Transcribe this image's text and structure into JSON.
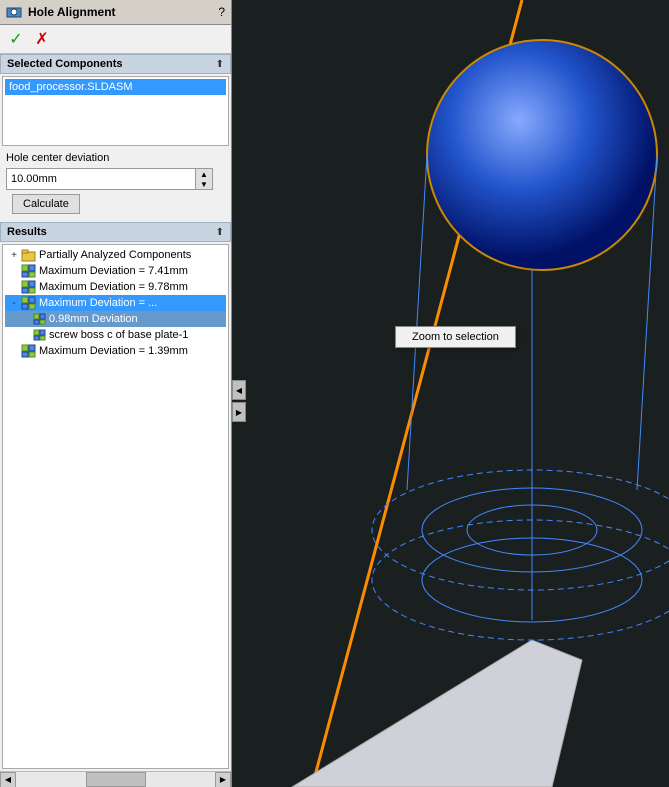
{
  "titleBar": {
    "title": "Hole Alignment",
    "helpLabel": "?"
  },
  "toolbar": {
    "checkLabel": "✓",
    "xLabel": "✗"
  },
  "selectedComponents": {
    "sectionTitle": "Selected Components",
    "items": [
      "food_processor.SLDASM"
    ]
  },
  "holeCenter": {
    "label": "Hole center deviation",
    "value": "10.00mm"
  },
  "calculateBtn": "Calculate",
  "results": {
    "sectionTitle": "Results",
    "items": [
      {
        "id": "partially-analyzed",
        "indent": 0,
        "expandable": true,
        "icon": "folder",
        "text": "Partially Analyzed Components",
        "selected": false
      },
      {
        "id": "max-dev-741",
        "indent": 0,
        "expandable": false,
        "icon": "gear",
        "text": "Maximum Deviation = 7.41mm",
        "selected": false
      },
      {
        "id": "max-dev-978",
        "indent": 0,
        "expandable": false,
        "icon": "gear",
        "text": "Maximum Deviation = 9.78mm",
        "selected": false
      },
      {
        "id": "max-dev-selected",
        "indent": 0,
        "expandable": true,
        "icon": "gear",
        "text": "Maximum Deviation = ...",
        "selected": true
      },
      {
        "id": "deviation-098",
        "indent": 1,
        "expandable": false,
        "icon": "gear-small",
        "text": "0.98mm Deviation",
        "selected": false,
        "contextSelected": true
      },
      {
        "id": "screw-boss",
        "indent": 1,
        "expandable": false,
        "icon": "gear-small",
        "text": "screw boss c of base plate-1",
        "selected": false
      },
      {
        "id": "max-dev-139",
        "indent": 0,
        "expandable": false,
        "icon": "gear",
        "text": "Maximum Deviation = 1.39mm",
        "selected": false
      }
    ]
  },
  "contextMenu": {
    "items": [
      "Zoom to selection"
    ]
  },
  "collapseArrows": {
    "left": "◀",
    "right": "▶"
  }
}
